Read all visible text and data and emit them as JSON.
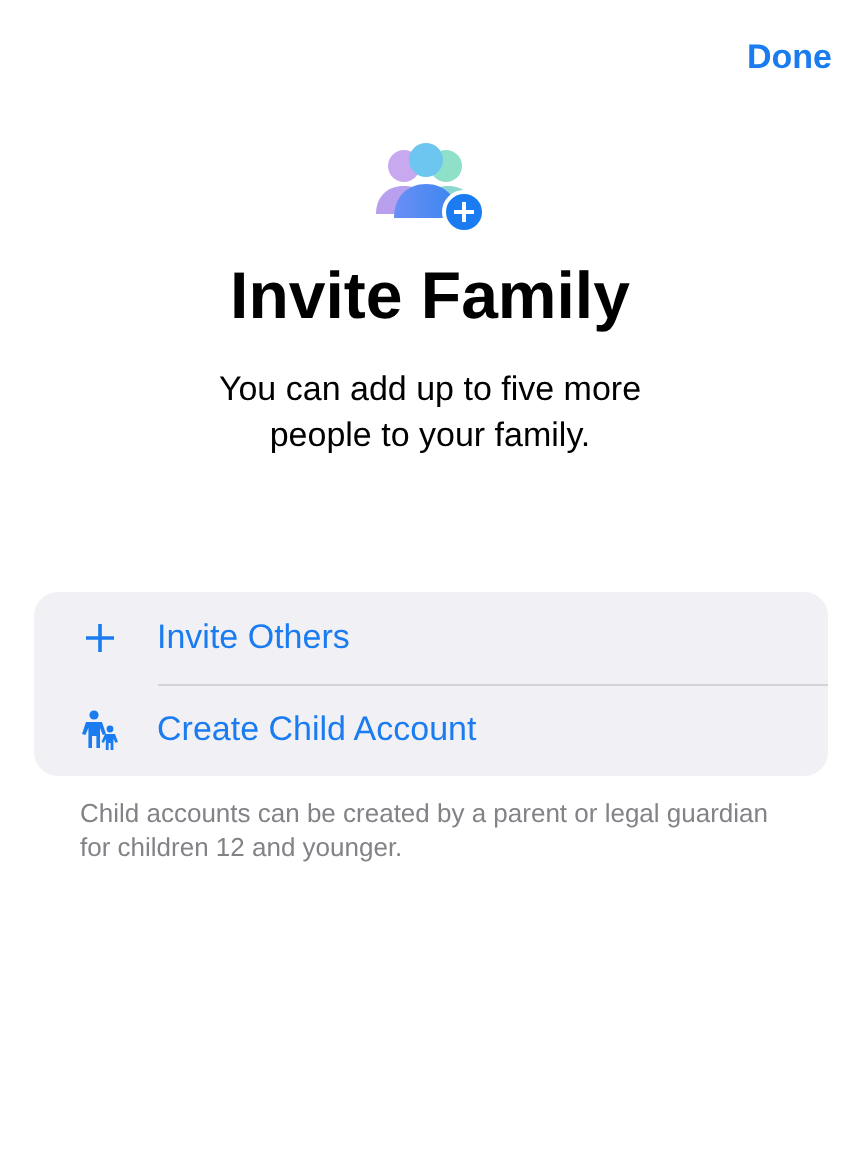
{
  "nav": {
    "done_label": "Done"
  },
  "title": "Invite Family",
  "subtitle": "You can add up to five more people to your family.",
  "actions": [
    {
      "kind": "plus",
      "label": "Invite Others"
    },
    {
      "kind": "child",
      "label": "Create Child Account"
    }
  ],
  "footnote": "Child accounts can be created by a parent or legal guardian for children 12 and younger."
}
